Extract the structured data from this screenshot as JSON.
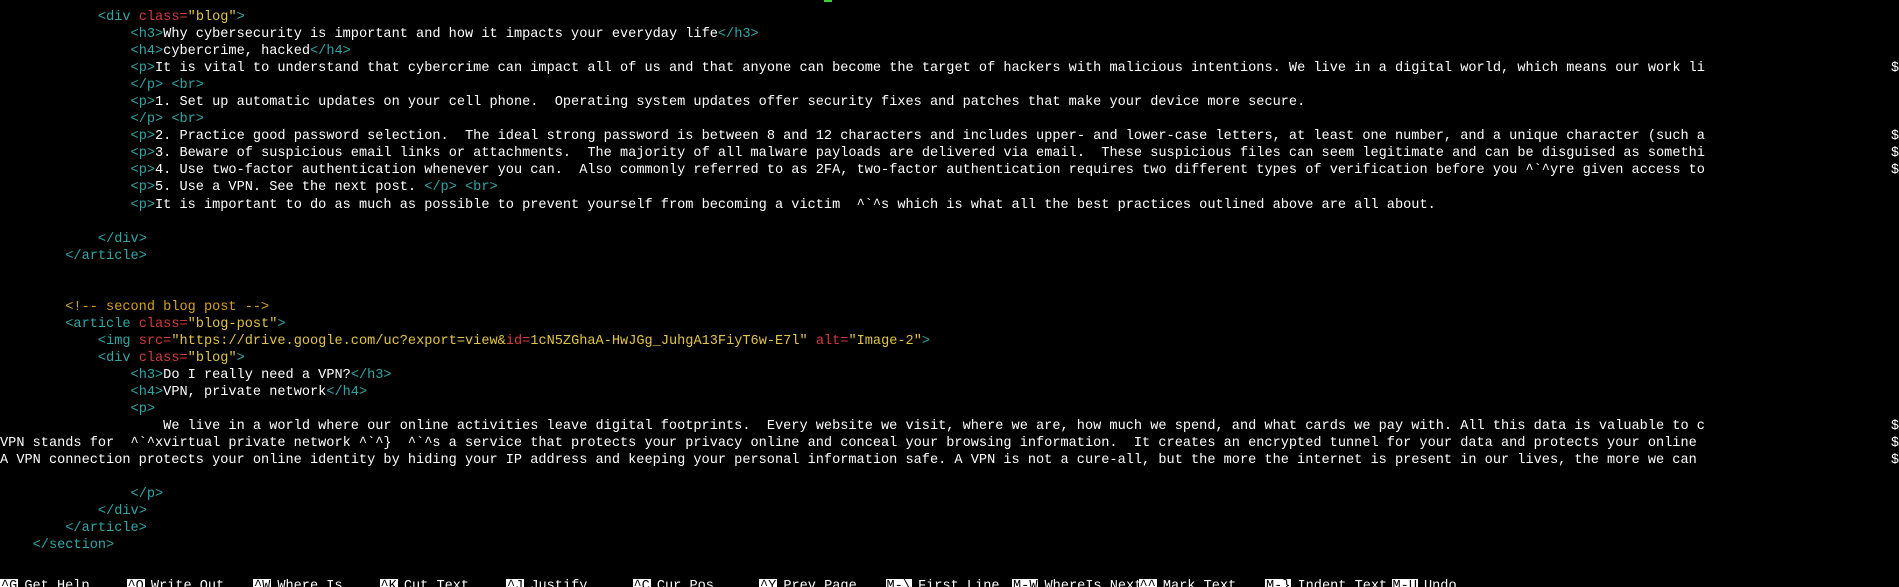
{
  "colors": {
    "background": "#000000",
    "tag": "#2fa6a6",
    "attribute": "#d43a3a",
    "string": "#e1c542",
    "comment": "#d4a020",
    "text": "#ffffff"
  },
  "overflow_marker": "$",
  "lines": [
    {
      "indent": 12,
      "segments": [
        {
          "t": "tag",
          "v": "<div "
        },
        {
          "t": "attr",
          "v": "class="
        },
        {
          "t": "str",
          "v": "\"blog\""
        },
        {
          "t": "tag",
          "v": ">"
        }
      ]
    },
    {
      "indent": 16,
      "segments": [
        {
          "t": "tag",
          "v": "<h3>"
        },
        {
          "t": "txt",
          "v": "Why cybersecurity is important and how it impacts your everyday life"
        },
        {
          "t": "tag",
          "v": "</h3>"
        }
      ]
    },
    {
      "indent": 16,
      "segments": [
        {
          "t": "tag",
          "v": "<h4>"
        },
        {
          "t": "txt",
          "v": "cybercrime, hacked"
        },
        {
          "t": "tag",
          "v": "</h4>"
        }
      ]
    },
    {
      "indent": 16,
      "overflow": true,
      "segments": [
        {
          "t": "tag",
          "v": "<p>"
        },
        {
          "t": "txt",
          "v": "It is vital to understand that cybercrime can impact all of us and that anyone can become the target of hackers with malicious intentions. We live in a digital world, which means our work li"
        }
      ]
    },
    {
      "indent": 16,
      "segments": [
        {
          "t": "tag",
          "v": "</p> <br>"
        }
      ]
    },
    {
      "indent": 16,
      "segments": [
        {
          "t": "tag",
          "v": "<p>"
        },
        {
          "t": "txt",
          "v": "1. Set up automatic updates on your cell phone.  Operating system updates offer security fixes and patches that make your device more secure."
        }
      ]
    },
    {
      "indent": 16,
      "segments": [
        {
          "t": "tag",
          "v": "</p> <br>"
        }
      ]
    },
    {
      "indent": 16,
      "overflow": true,
      "segments": [
        {
          "t": "tag",
          "v": "<p>"
        },
        {
          "t": "txt",
          "v": "2. Practice good password selection.  The ideal strong password is between 8 and 12 characters and includes upper- and lower-case letters, at least one number, and a unique character (such a"
        }
      ]
    },
    {
      "indent": 16,
      "overflow": true,
      "segments": [
        {
          "t": "tag",
          "v": "<p>"
        },
        {
          "t": "txt",
          "v": "3. Beware of suspicious email links or attachments.  The majority of all malware payloads are delivered via email.  These suspicious files can seem legitimate and can be disguised as somethi"
        }
      ]
    },
    {
      "indent": 16,
      "overflow": true,
      "segments": [
        {
          "t": "tag",
          "v": "<p>"
        },
        {
          "t": "txt",
          "v": "4. Use two-factor authentication whenever you can.  Also commonly referred to as 2FA, two-factor authentication requires two different types of verification before you ^`^yre given access to"
        }
      ]
    },
    {
      "indent": 16,
      "segments": [
        {
          "t": "tag",
          "v": "<p>"
        },
        {
          "t": "txt",
          "v": "5. Use a VPN. See the next post. "
        },
        {
          "t": "tag",
          "v": "</p> <br>"
        }
      ]
    },
    {
      "indent": 16,
      "segments": [
        {
          "t": "tag",
          "v": "<p>"
        },
        {
          "t": "txt",
          "v": "It is important to do as much as possible to prevent yourself from becoming a victim  ^`^s which is what all the best practices outlined above are all about."
        }
      ]
    },
    {
      "indent": 0,
      "segments": []
    },
    {
      "indent": 12,
      "segments": [
        {
          "t": "tag",
          "v": "</div>"
        }
      ]
    },
    {
      "indent": 8,
      "segments": [
        {
          "t": "tag",
          "v": "</article>"
        }
      ]
    },
    {
      "indent": 0,
      "segments": []
    },
    {
      "indent": 0,
      "segments": []
    },
    {
      "indent": 8,
      "segments": [
        {
          "t": "cmt",
          "v": "<!-- second blog post -->"
        }
      ]
    },
    {
      "indent": 8,
      "segments": [
        {
          "t": "tag",
          "v": "<article "
        },
        {
          "t": "attr",
          "v": "class="
        },
        {
          "t": "str",
          "v": "\"blog-post\""
        },
        {
          "t": "tag",
          "v": ">"
        }
      ]
    },
    {
      "indent": 12,
      "segments": [
        {
          "t": "tag",
          "v": "<img "
        },
        {
          "t": "attr",
          "v": "src="
        },
        {
          "t": "str",
          "v": "\"https://drive.google.com/uc?export=view&"
        },
        {
          "t": "attr",
          "v": "id="
        },
        {
          "t": "str",
          "v": "1cN5ZGhaA-HwJGg_JuhgA13FiyT6w-E7l\" "
        },
        {
          "t": "attr",
          "v": "alt="
        },
        {
          "t": "str",
          "v": "\"Image-2\""
        },
        {
          "t": "tag",
          "v": ">"
        }
      ]
    },
    {
      "indent": 12,
      "segments": [
        {
          "t": "tag",
          "v": "<div "
        },
        {
          "t": "attr",
          "v": "class="
        },
        {
          "t": "str",
          "v": "\"blog\""
        },
        {
          "t": "tag",
          "v": ">"
        }
      ]
    },
    {
      "indent": 16,
      "segments": [
        {
          "t": "tag",
          "v": "<h3>"
        },
        {
          "t": "txt",
          "v": "Do I really need a VPN?"
        },
        {
          "t": "tag",
          "v": "</h3>"
        }
      ]
    },
    {
      "indent": 16,
      "segments": [
        {
          "t": "tag",
          "v": "<h4>"
        },
        {
          "t": "txt",
          "v": "VPN, private network"
        },
        {
          "t": "tag",
          "v": "</h4>"
        }
      ]
    },
    {
      "indent": 16,
      "segments": [
        {
          "t": "tag",
          "v": "<p>"
        }
      ]
    },
    {
      "indent": 20,
      "overflow": true,
      "segments": [
        {
          "t": "txt",
          "v": "We live in a world where our online activities leave digital footprints.  Every website we visit, where we are, how much we spend, and what cards we pay with. All this data is valuable to c"
        }
      ]
    },
    {
      "indent": 0,
      "overflow": true,
      "segments": [
        {
          "t": "txt",
          "v": "VPN stands for  ^`^xvirtual private network ^`^}  ^`^s a service that protects your privacy online and conceal your browsing information.  It creates an encrypted tunnel for your data and protects your online "
        }
      ]
    },
    {
      "indent": 0,
      "overflow": true,
      "segments": [
        {
          "t": "txt",
          "v": "A VPN connection protects your online identity by hiding your IP address and keeping your personal information safe. A VPN is not a cure-all, but the more the internet is present in our lives, the more we can "
        }
      ]
    },
    {
      "indent": 0,
      "segments": []
    },
    {
      "indent": 16,
      "segments": [
        {
          "t": "tag",
          "v": "</p>"
        }
      ]
    },
    {
      "indent": 12,
      "segments": [
        {
          "t": "tag",
          "v": "</div>"
        }
      ]
    },
    {
      "indent": 8,
      "segments": [
        {
          "t": "tag",
          "v": "</article>"
        }
      ]
    },
    {
      "indent": 4,
      "segments": [
        {
          "t": "tag",
          "v": "</section>"
        }
      ]
    }
  ],
  "shortcuts": [
    {
      "key": "^G",
      "label": "Get Help"
    },
    {
      "key": "^O",
      "label": "Write Out"
    },
    {
      "key": "^W",
      "label": "Where Is"
    },
    {
      "key": "^K",
      "label": "Cut Text"
    },
    {
      "key": "^J",
      "label": "Justify"
    },
    {
      "key": "^C",
      "label": "Cur Pos"
    },
    {
      "key": "^Y",
      "label": "Prev Page"
    },
    {
      "key": "M-\\",
      "label": "First Line"
    },
    {
      "key": "M-W",
      "label": "WhereIs Next"
    },
    {
      "key": "^^",
      "label": "Mark Text"
    },
    {
      "key": "M-}",
      "label": "Indent Text"
    },
    {
      "key": "M-U",
      "label": "Undo"
    }
  ]
}
